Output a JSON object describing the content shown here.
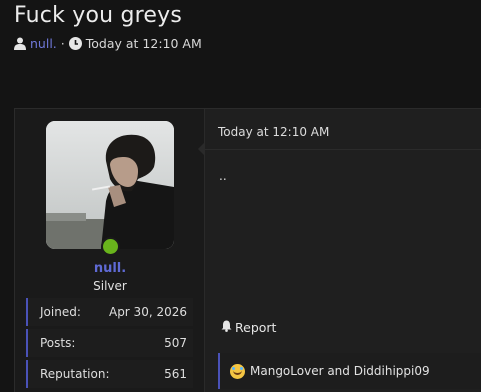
{
  "thread": {
    "title": "Fuck you greys"
  },
  "meta": {
    "author": "null.",
    "separator": "·",
    "timestamp": "Today at 12:10 AM",
    "user_icon": "user-icon",
    "clock_icon": "clock-icon"
  },
  "post": {
    "date": "Today at 12:10 AM",
    "body": "..",
    "report_label": "Report",
    "report_icon": "bell-icon",
    "reaction_icon": "laughing-emoji-icon",
    "reactions_text": "MangoLover and Diddihippi09"
  },
  "user": {
    "username": "null.",
    "title": "Silver",
    "online": true,
    "stats": [
      {
        "label": "Joined:",
        "value": "Apr 30, 2026"
      },
      {
        "label": "Posts:",
        "value": "507"
      },
      {
        "label": "Reputation:",
        "value": "561"
      }
    ]
  },
  "colors": {
    "background": "#141414",
    "panel": "#1a1a1a",
    "accent": "#5f6ad4",
    "online": "#69b41c"
  }
}
